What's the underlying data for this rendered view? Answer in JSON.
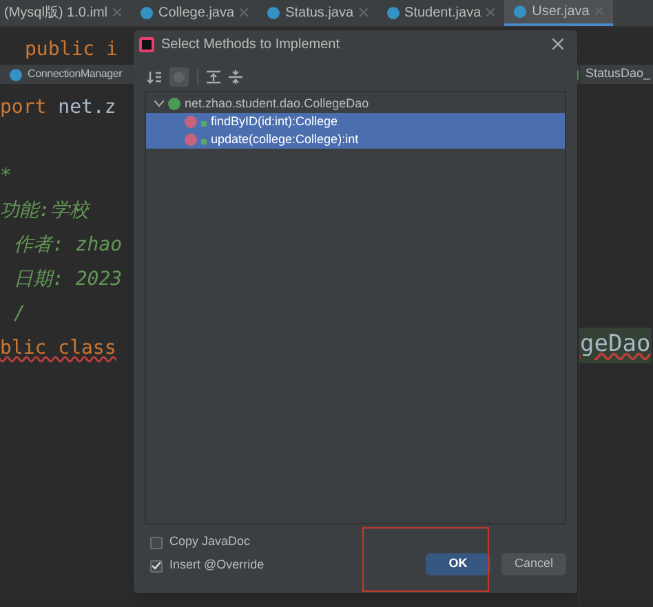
{
  "editor_tabs": [
    {
      "label": "(Mysql版) 1.0.iml",
      "selected": false
    },
    {
      "label": "College.java",
      "selected": false
    },
    {
      "label": "Status.java",
      "selected": false
    },
    {
      "label": "Student.java",
      "selected": false
    },
    {
      "label": "User.java",
      "selected": true
    }
  ],
  "file_tabs_left": "ConnectionManager",
  "file_tabs_right": "StatusDao_",
  "code_lines": [
    {
      "text": "public i",
      "kind": "keyword"
    },
    {
      "text": "port net.z",
      "kind": "import"
    },
    {
      "kind": "blank"
    },
    {
      "text": "*",
      "kind": "comment"
    },
    {
      "text": "功能:学校",
      "kind": "comment"
    },
    {
      "text": "作者: zhao",
      "kind": "comment"
    },
    {
      "text": "日期: 2023",
      "kind": "comment"
    },
    {
      "text": "/",
      "kind": "comment"
    },
    {
      "text": "blic class",
      "kind": "error"
    }
  ],
  "code_right": "geDao",
  "dialog": {
    "title": "Select Methods to Implement",
    "tree": {
      "label": "net.zhao.student.dao.CollegeDao",
      "expanded": true,
      "children": [
        {
          "label": "findByID(id:int):College",
          "selected": true
        },
        {
          "label": "update(college:College):int",
          "selected": true
        }
      ]
    },
    "options": [
      {
        "label": "Copy JavaDoc",
        "checked": false
      },
      {
        "label": "Insert @Override",
        "checked": true
      }
    ],
    "buttons": [
      {
        "label": "OK",
        "kind": "primary"
      },
      {
        "label": "Cancel",
        "kind": "default"
      }
    ]
  }
}
